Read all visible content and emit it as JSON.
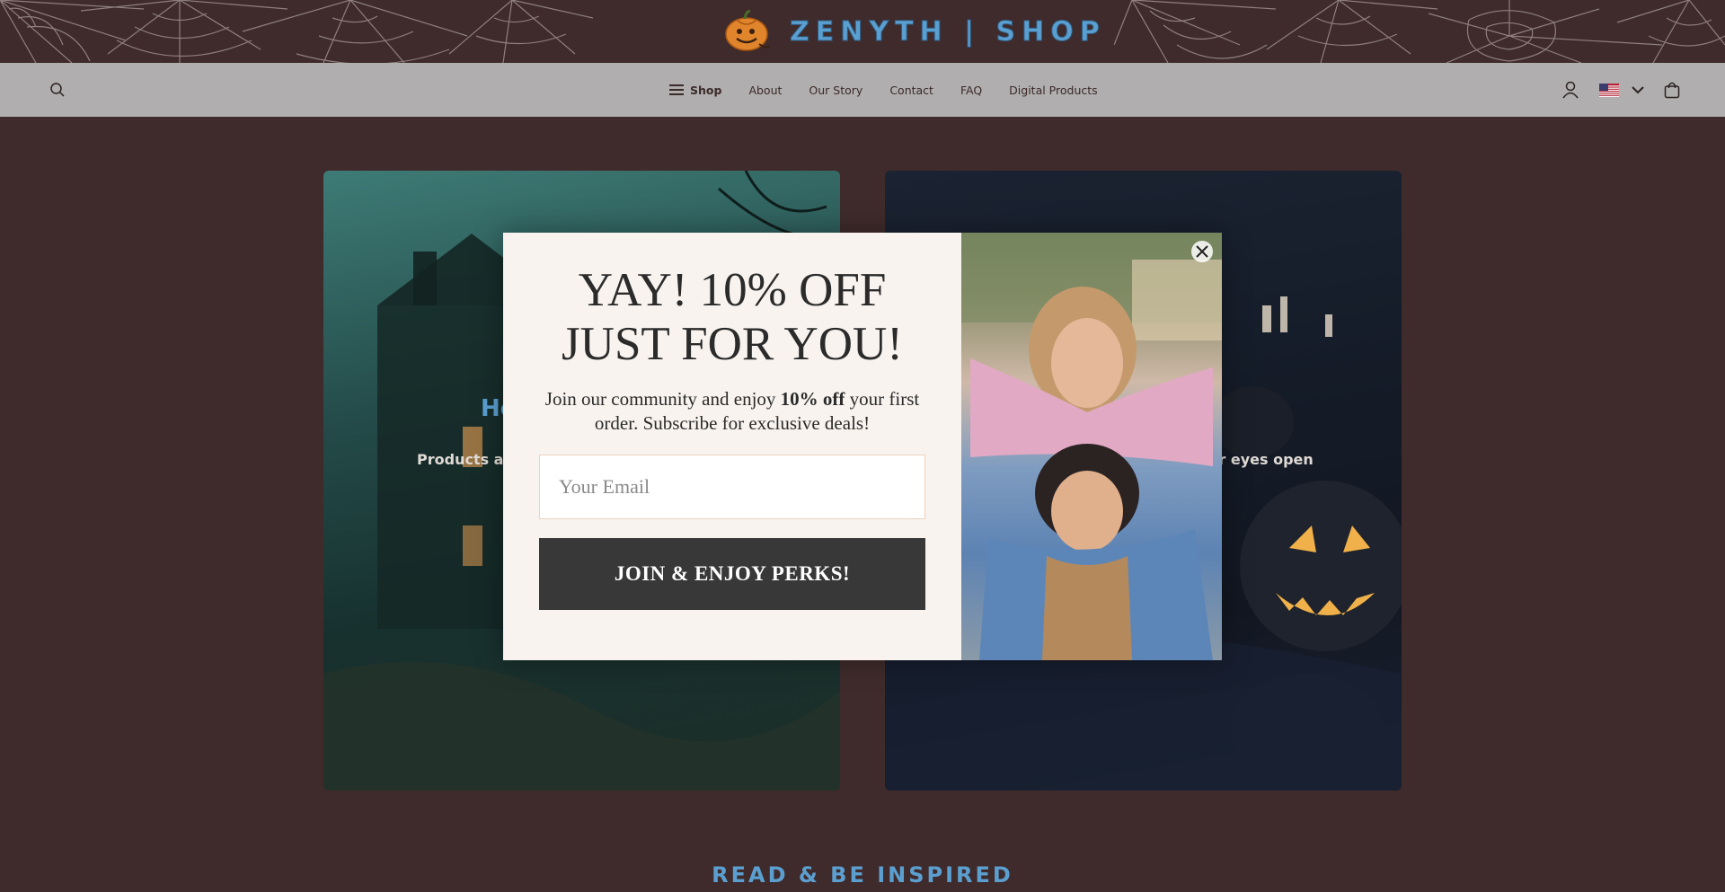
{
  "brand": {
    "name": "ZENYTH | SHOP"
  },
  "nav": {
    "items": [
      {
        "label": "Shop"
      },
      {
        "label": "About"
      },
      {
        "label": "Our Story"
      },
      {
        "label": "Contact"
      },
      {
        "label": "FAQ"
      },
      {
        "label": "Digital Products"
      }
    ],
    "icons": [
      "search-icon",
      "hamburger-icon",
      "account-icon",
      "us-flag-icon",
      "chevron-down-icon",
      "bag-icon"
    ]
  },
  "cards": [
    {
      "title_fragment": "Ho",
      "subtitle_fragment": "Products are"
    },
    {
      "title_fragment": "",
      "subtitle_fragment": "ur eyes open"
    }
  ],
  "section": {
    "heading": "READ & BE INSPIRED"
  },
  "popup": {
    "heading_line1": "YAY! 10% OFF",
    "heading_line2": "JUST FOR YOU!",
    "text_before": "Join our community and enjoy ",
    "text_bold": "10% off",
    "text_after": " your first order. Subscribe for exclusive deals!",
    "email_placeholder": "Your Email",
    "email_value": "",
    "button_label": "JOIN & ENJOY PERKS!"
  },
  "colors": {
    "background": "#3f2b2b",
    "nav": "#b0aeae",
    "brand_blue": "#5b9fd1",
    "popup_bg": "#f8f3ef",
    "button": "#383838"
  }
}
